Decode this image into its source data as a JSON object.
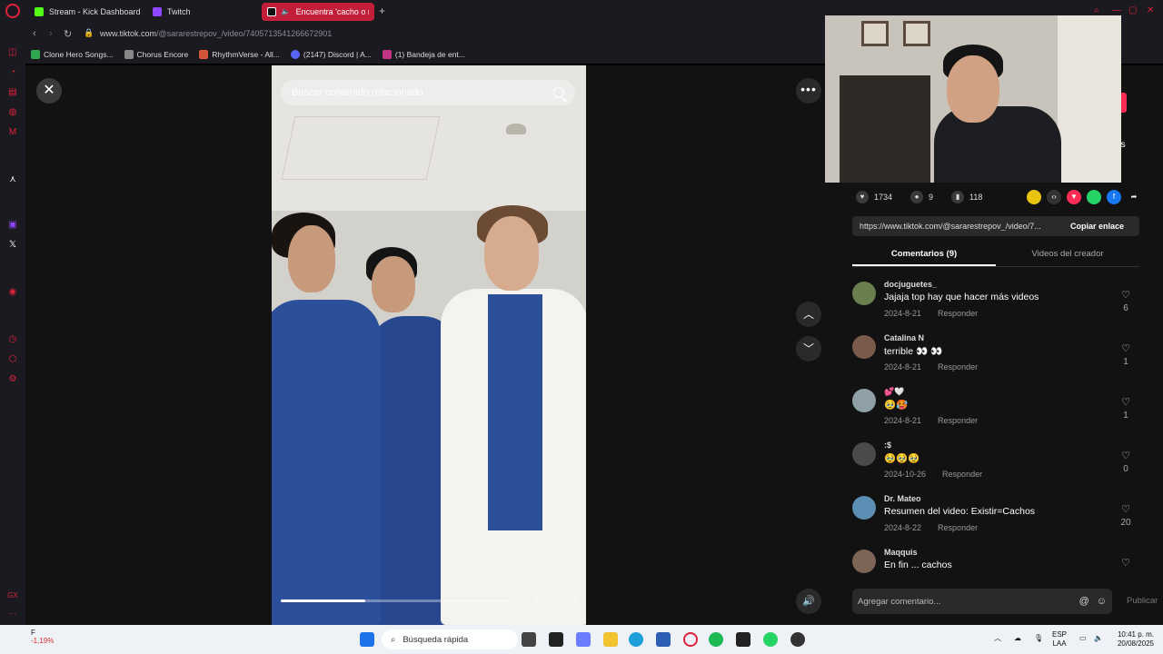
{
  "browser": {
    "tabs": [
      {
        "label": "Stream - Kick Dashboard",
        "color": "#53fc18"
      },
      {
        "label": "Twitch",
        "color": "#9146ff"
      },
      {
        "label": "Encuentra 'cacho o n",
        "color": "#ffffff"
      }
    ],
    "url_host": "www.tiktok.com",
    "url_path": "/@sararestrepov_/video/7405713541266672901",
    "bookmarks": [
      {
        "label": "Clone Hero Songs...",
        "color": "#2fa84f"
      },
      {
        "label": "Chorus Encore",
        "color": "#888888"
      },
      {
        "label": "RhythmVerse - All...",
        "color": "#d4553a"
      },
      {
        "label": "(2147) Discord | A...",
        "color": "#5865f2"
      },
      {
        "label": "(1) Bandeja de ent...",
        "color": "#c13584"
      }
    ]
  },
  "video": {
    "search_placeholder": "Buscar contenido relacionado",
    "progress": 0.37,
    "time": "00:02/02:09"
  },
  "panel": {
    "mas": "ás",
    "likes": "1734",
    "comments_count": "9",
    "saves": "118",
    "link": "https://www.tiktok.com/@sararestrepov_/video/7...",
    "copy_label": "Copiar enlace",
    "tab_comments": "Comentarios (9)",
    "tab_creator": "Videos del creador",
    "reply_label": "Responder",
    "comments": [
      {
        "user": "docjuguetes_",
        "text": "Jajaja top hay que hacer más videos",
        "date": "2024-8-21",
        "likes": "6",
        "avatar": "#6a7f4e"
      },
      {
        "user": "Catalina N",
        "text": "terrible 👀 👀",
        "date": "2024-8-21",
        "likes": "1",
        "avatar": "#7a5a4a"
      },
      {
        "user": "💕🤍",
        "text": "🥹🥵",
        "date": "2024-8-21",
        "likes": "1",
        "avatar": "#8fa0a8"
      },
      {
        "user": ":$",
        "text": "🥹🥹🥹",
        "date": "2024-10-26",
        "likes": "0",
        "avatar": "#4a4a4a"
      },
      {
        "user": "Dr. Mateo",
        "text": "Resumen del video: Existir=Cachos",
        "date": "2024-8-22",
        "likes": "20",
        "avatar": "#5d8fb5"
      },
      {
        "user": "Maqquis",
        "text": "En fin ... cachos",
        "date": "",
        "likes": "",
        "avatar": "#7c6457"
      }
    ],
    "add_comment_placeholder": "Agregar comentario...",
    "publish_label": "Publicar"
  },
  "taskbar": {
    "weather_temp": "F",
    "weather_change": "-1,19%",
    "search_label": "Búsqueda rápida",
    "lang_top": "ESP",
    "lang_bottom": "LAA",
    "time": "10:41 p. m.",
    "date": "20/08/2025"
  }
}
